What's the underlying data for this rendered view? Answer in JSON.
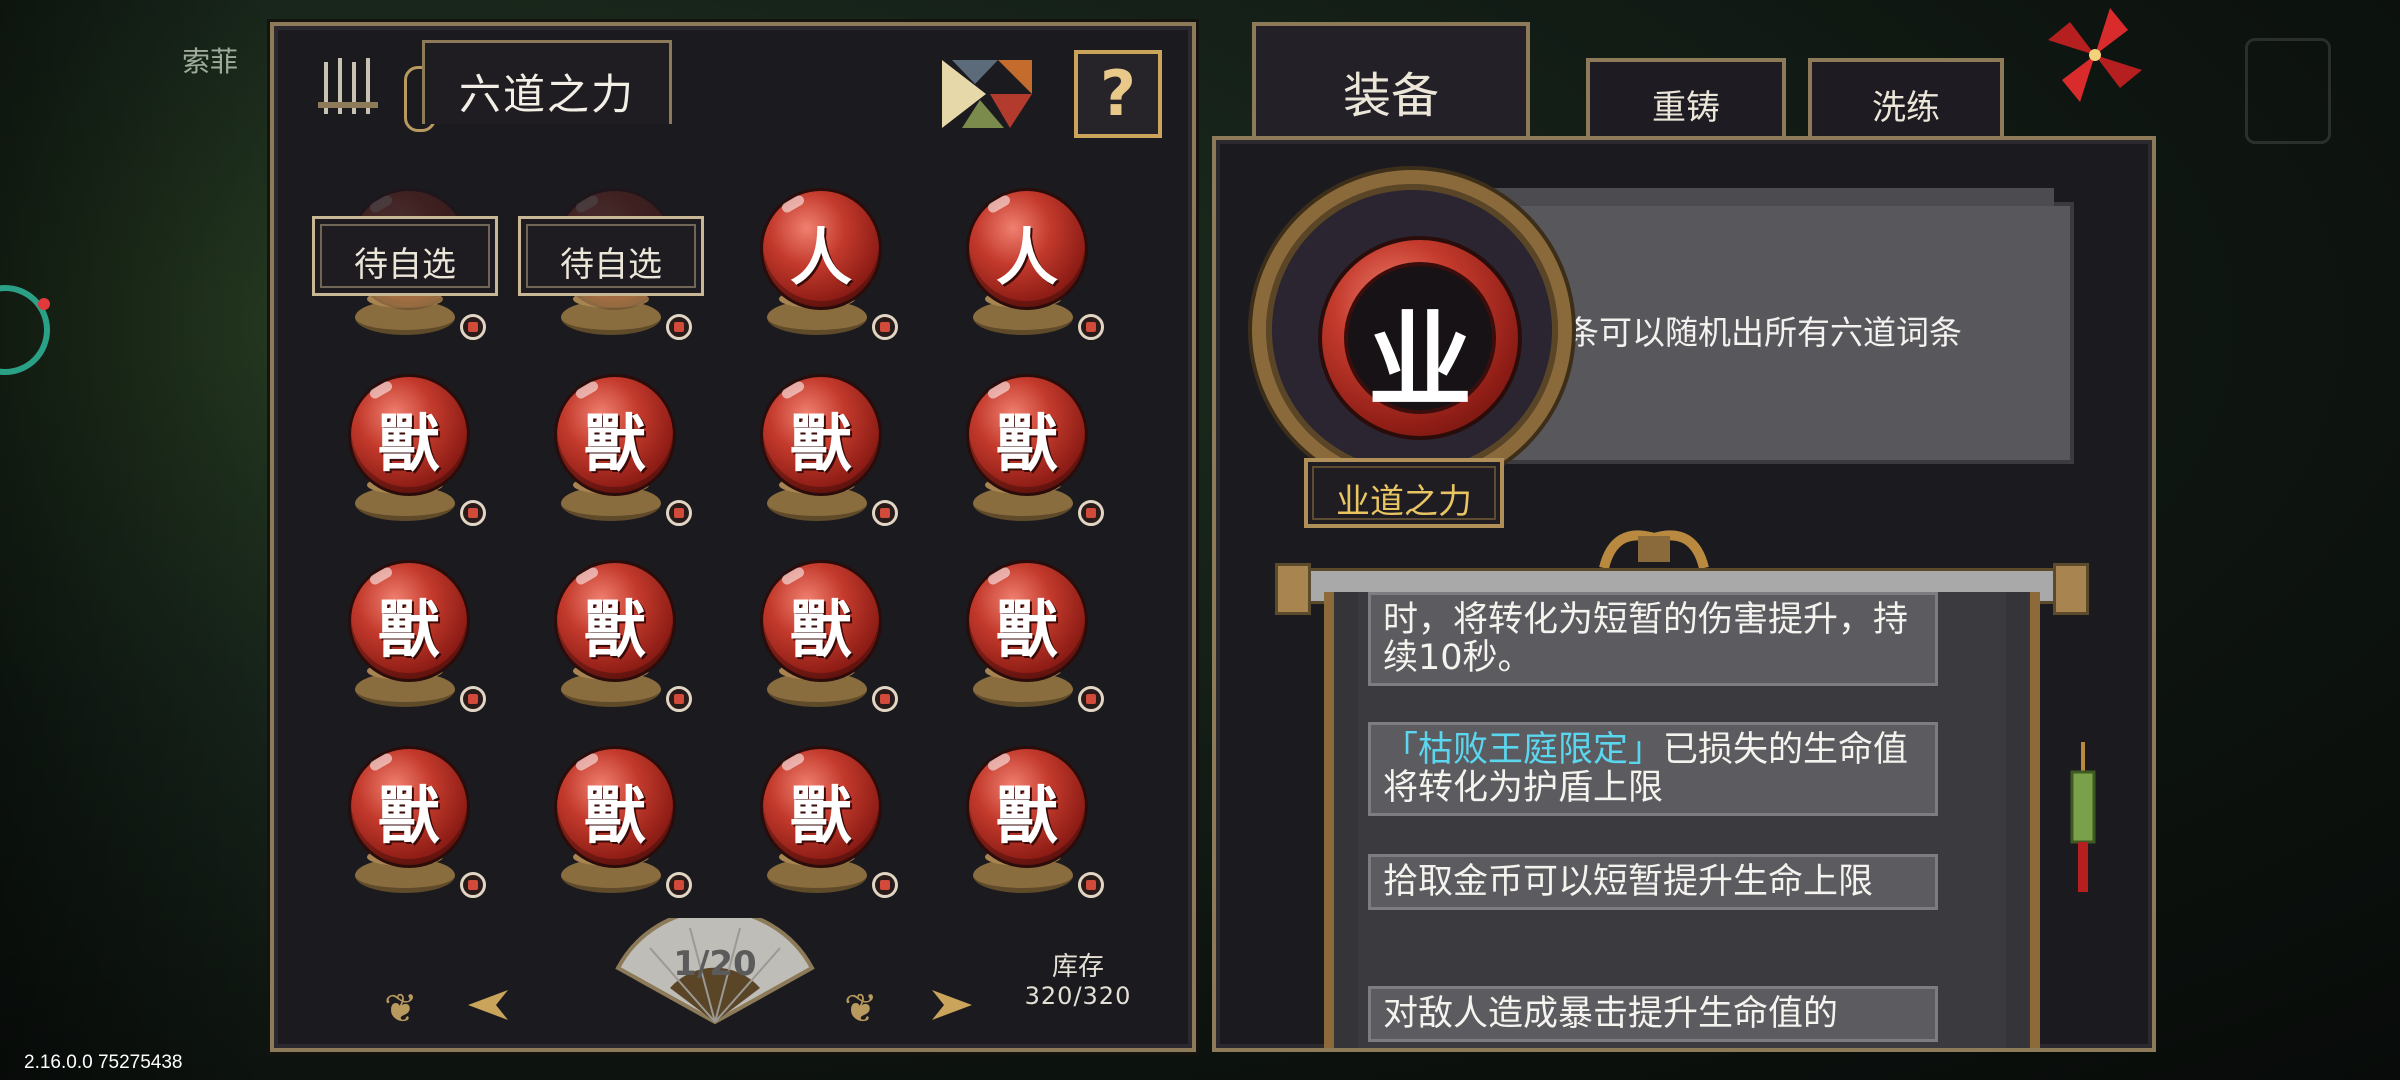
{
  "background": {
    "player_name": "索菲",
    "version": "2.16.0.0 75275438"
  },
  "left_panel": {
    "title": "六道之力",
    "help_label": "?",
    "slots": [
      {
        "type": "placeholder",
        "label": "待自选"
      },
      {
        "type": "placeholder",
        "label": "待自选"
      },
      {
        "type": "orb",
        "glyph": "人"
      },
      {
        "type": "orb",
        "glyph": "人"
      },
      {
        "type": "orb",
        "glyph": "獸"
      },
      {
        "type": "orb",
        "glyph": "獸"
      },
      {
        "type": "orb",
        "glyph": "獸"
      },
      {
        "type": "orb",
        "glyph": "獸"
      },
      {
        "type": "orb",
        "glyph": "獸"
      },
      {
        "type": "orb",
        "glyph": "獸"
      },
      {
        "type": "orb",
        "glyph": "獸"
      },
      {
        "type": "orb",
        "glyph": "獸"
      },
      {
        "type": "orb",
        "glyph": "獸"
      },
      {
        "type": "orb",
        "glyph": "獸"
      },
      {
        "type": "orb",
        "glyph": "獸"
      },
      {
        "type": "orb",
        "glyph": "獸"
      }
    ],
    "pager": {
      "page": "1/20"
    },
    "stock": {
      "label": "库存",
      "value": "320/320"
    }
  },
  "right_panel": {
    "tabs": [
      {
        "label": "装备",
        "active": true
      },
      {
        "label": "重铸",
        "active": false
      },
      {
        "label": "洗练",
        "active": false
      }
    ],
    "item": {
      "glyph": "业",
      "name": "业道之力",
      "description": "副词条可以随机出所有六道词条"
    },
    "entries": [
      {
        "parts": [
          {
            "text": "时，将转化为短暂的伤害提升，持续10秒。",
            "highlight": false
          }
        ]
      },
      {
        "parts": [
          {
            "text": "「枯败王庭限定」",
            "highlight": true
          },
          {
            "text": "已损失的生命值将转化为护盾上限",
            "highlight": false
          }
        ]
      },
      {
        "parts": [
          {
            "text": "拾取金币可以短暂提升生命上限",
            "highlight": false
          }
        ]
      },
      {
        "parts": [
          {
            "text": "对敌人造成暴击提升生命值的",
            "highlight": false
          }
        ]
      }
    ]
  },
  "colors": {
    "panel_bg": "#1b1a1f",
    "frame_gold": "#8c7a58",
    "orb_red": "#c33a2c",
    "name_gold": "#e8c462",
    "highlight_cyan": "#5ad6ef"
  },
  "icons": [
    "sword-rack-icon",
    "tangram-icon",
    "help-icon",
    "arrow-left-icon",
    "arrow-right-icon",
    "fan-icon",
    "pinwheel-icon",
    "tassel-icon"
  ]
}
